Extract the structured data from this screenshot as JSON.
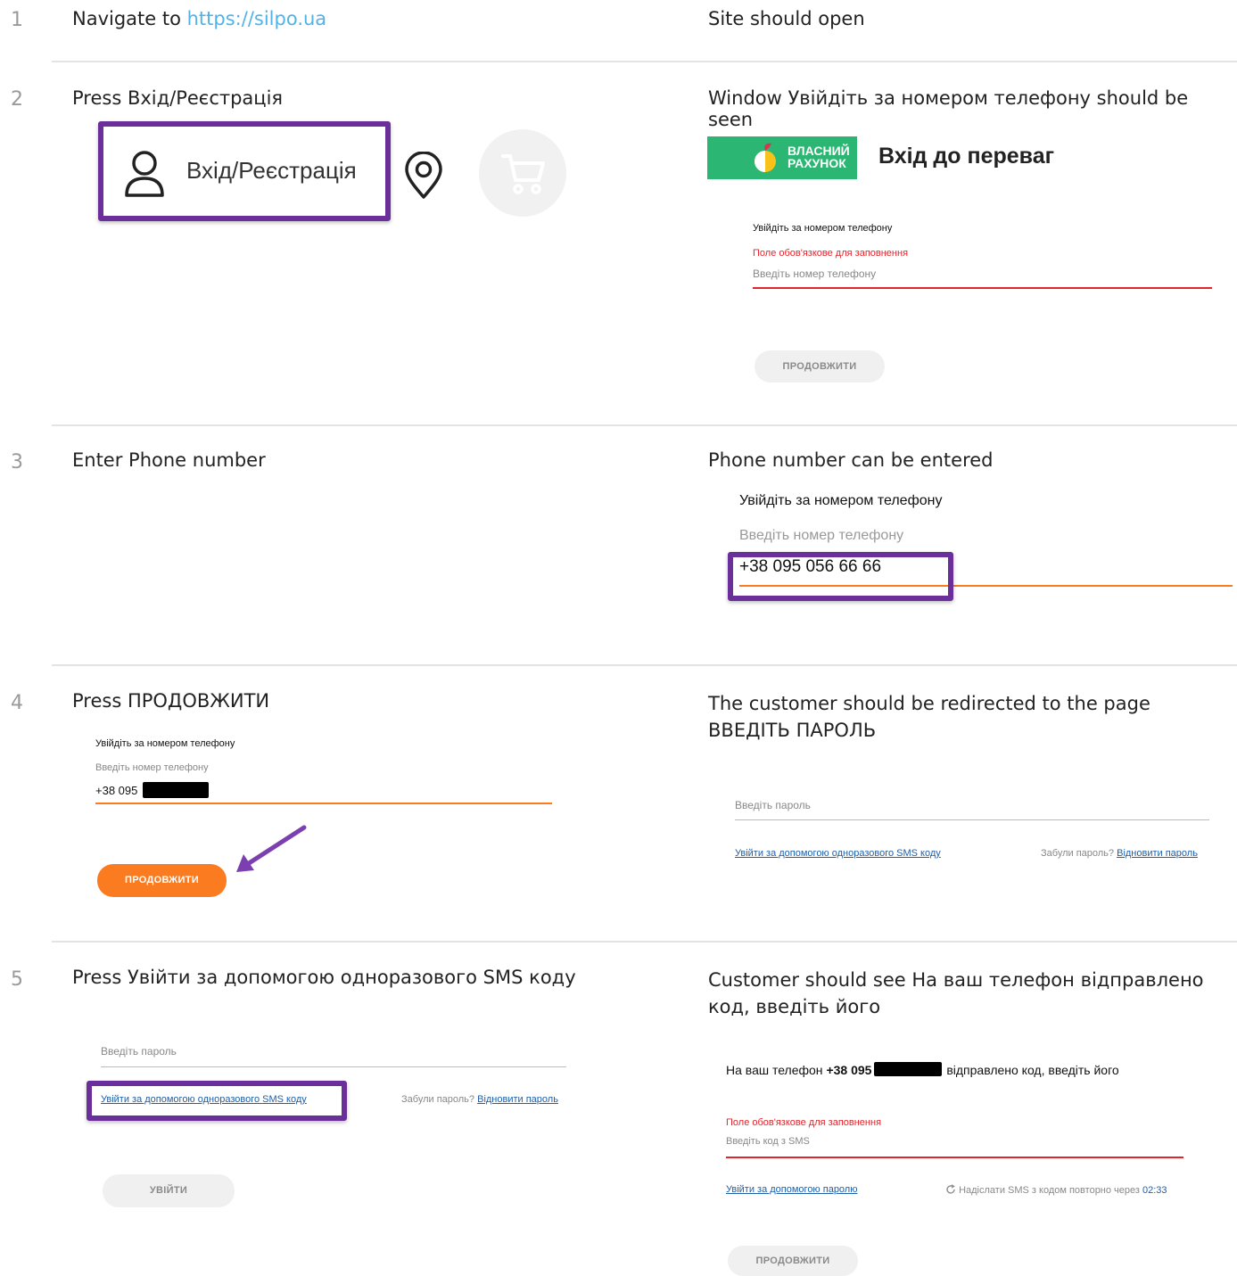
{
  "steps": [
    {
      "num": "1",
      "action_prefix": "Navigate to ",
      "action_link": "https://silpo.ua",
      "expected": "Site should open"
    },
    {
      "num": "2",
      "action_prefix": "Press ",
      "action_emph": "Вхід/Реєстрація",
      "expected_prefix": "Window ",
      "expected_emph": "Увійдіть за номером телефону",
      "expected_suffix": " should be seen"
    },
    {
      "num": "3",
      "action": "Enter Phone number",
      "expected": "Phone number can be entered"
    },
    {
      "num": "4",
      "action_prefix": "Press ",
      "action_emph": "ПРОДОВЖИТИ",
      "expected_prefix": "The customer should be redirected to the page ",
      "expected_emph": "ВВЕДІТЬ ПАРОЛЬ"
    },
    {
      "num": "5",
      "action_prefix": "Press ",
      "action_emph": "Увійти за допомогою одноразового SMS коду",
      "expected_prefix": "Customer should see ",
      "expected_emph": "На ваш телефон відправлено код, введіть його"
    }
  ],
  "s2": {
    "login_label": "Вхід/Реєстрація",
    "logo_line1": "ВЛАСНИЙ",
    "logo_line2": "РАХУНОК",
    "heading": "Вхід до переваг",
    "field_label": "Увійдіть за номером телефону",
    "error": "Поле обов'язкове для заповнення",
    "placeholder": "Введіть номер телефону",
    "button": "ПРОДОВЖИТИ"
  },
  "s3": {
    "field_label": "Увійдіть за номером телефону",
    "placeholder": "Введіть номер телефону",
    "value": "+38 095 056 66 66"
  },
  "s4": {
    "field_label": "Увійдіть за номером телефону",
    "placeholder": "Введіть номер телефону",
    "value_prefix": "+38 095",
    "button": "ПРОДОВЖИТИ",
    "password_placeholder": "Введіть пароль",
    "sms_link": "Увійти за допомогою одноразового SMS коду",
    "forgot": "Забули пароль?",
    "restore": "Відновити пароль"
  },
  "s5": {
    "password_placeholder": "Введіть пароль",
    "sms_link": "Увійти за допомогою одноразового SMS коду",
    "forgot": "Забули пароль?",
    "restore": "Відновити пароль",
    "login_button": "УВІЙТИ",
    "msg_prefix": "На ваш телефон ",
    "msg_phone": "+38 095",
    "msg_suffix": " відправлено код, введіть його",
    "error": "Поле обов'язкове для заповнення",
    "code_placeholder": "Введіть код з SMS",
    "password_link": "Увійти за допомогою паролю",
    "resend": "Надіслати SMS з кодом повторно через ",
    "timer": "02:33",
    "button": "ПРОДОВЖИТИ"
  },
  "colors": {
    "purple": "#6a2f9a",
    "orange": "#fb7b20",
    "red": "#e3242b",
    "link": "#4fb3ea",
    "green": "#2bb673"
  },
  "icons": [
    "user-icon",
    "location-pin-icon",
    "cart-icon",
    "refresh-icon",
    "arrow-icon"
  ]
}
